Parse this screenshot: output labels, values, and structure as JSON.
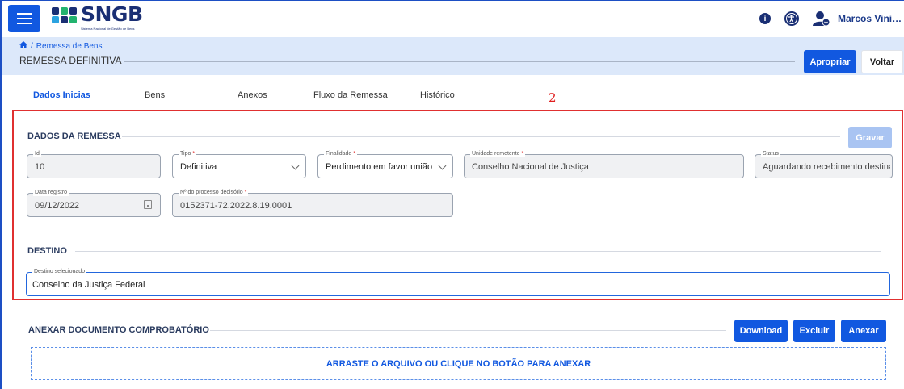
{
  "header": {
    "logo_text": "SNGB",
    "logo_subtitle": "Sistema Nacional de Gestão de Bens",
    "info_icon_glyph": "i",
    "user_name": "Marcos Vinicius Satyro C..."
  },
  "subheader": {
    "breadcrumb_label": "Remessa de Bens",
    "page_title": "REMESSA DEFINITIVA",
    "apropriar_label": "Apropriar",
    "voltar_label": "Voltar"
  },
  "tabs": [
    {
      "label": "Dados Inicias",
      "active": true
    },
    {
      "label": "Bens",
      "active": false
    },
    {
      "label": "Anexos",
      "active": false
    },
    {
      "label": "Fluxo da Remessa",
      "active": false
    },
    {
      "label": "Histórico",
      "active": false
    }
  ],
  "annotation": "2",
  "dados": {
    "section_title": "DADOS DA REMESSA",
    "gravar_label": "Gravar",
    "fields": {
      "id": {
        "label": "Id",
        "value": "10"
      },
      "tipo": {
        "label": "Tipo",
        "value": "Definitiva"
      },
      "finalidade": {
        "label": "Finalidade",
        "value": "Perdimento em favor união"
      },
      "unidade": {
        "label": "Unidade remetente",
        "value": "Conselho Nacional de Justiça"
      },
      "status": {
        "label": "Status",
        "value": "Aguardando recebimento destina"
      },
      "data_registro": {
        "label": "Data registro",
        "value": "09/12/2022"
      },
      "processo": {
        "label": "Nº do processo decisório",
        "value": "0152371-72.2022.8.19.0001"
      }
    }
  },
  "destino": {
    "section_title": "DESTINO",
    "field_label": "Destino selecionado",
    "field_value": "Conselho da Justiça Federal"
  },
  "anexar": {
    "section_title": "ANEXAR DOCUMENTO COMPROBATÓRIO",
    "download_label": "Download",
    "excluir_label": "Excluir",
    "anexar_label": "Anexar",
    "dropzone_text": "ARRASTE O ARQUIVO OU CLIQUE NO BOTÃO PARA ANEXAR"
  },
  "colors": {
    "primary": "#1158e0",
    "brand_navy": "#1a2f74",
    "subheader_bg": "#dce8fa",
    "highlight_border": "#e03030"
  }
}
